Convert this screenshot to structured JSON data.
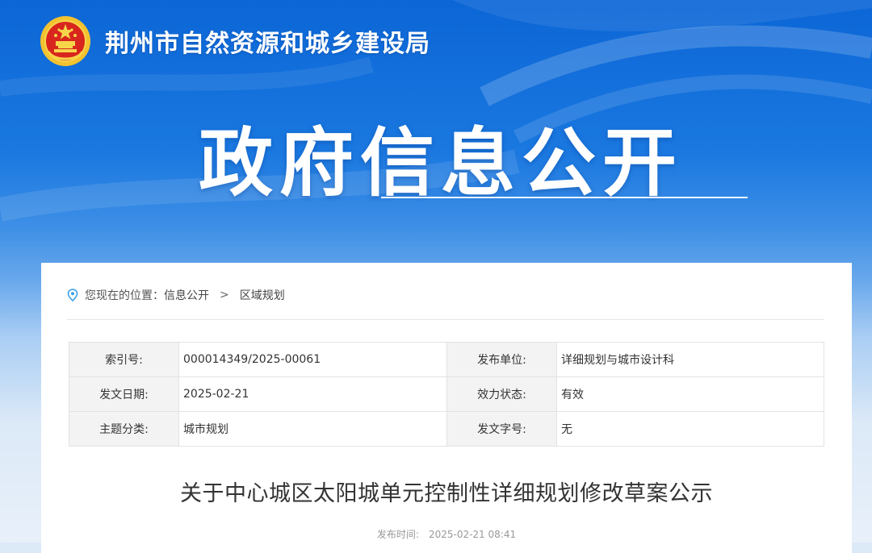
{
  "header": {
    "site_title": "荆州市自然资源和城乡建设局",
    "emblem_icon": "national-emblem-icon"
  },
  "banner": {
    "title": "政府信息公开"
  },
  "breadcrumb": {
    "prefix": "您现在的位置：",
    "items": [
      "信息公开",
      "区域规划"
    ],
    "separator": ">"
  },
  "meta": {
    "rows": [
      {
        "k1": "索引号:",
        "v1": "000014349/2025-00061",
        "k2": "发布单位:",
        "v2": "详细规划与城市设计科"
      },
      {
        "k1": "发文日期:",
        "v1": "2025-02-21",
        "k2": "效力状态:",
        "v2": "有效"
      },
      {
        "k1": "主题分类:",
        "v1": "城市规划",
        "k2": "发文字号:",
        "v2": "无"
      }
    ]
  },
  "article": {
    "title": "关于中心城区太阳城单元控制性详细规划修改草案公示",
    "publish_label": "发布时间:",
    "publish_time": "2025-02-21 08:41"
  },
  "colors": {
    "brand_blue": "#0c66d6",
    "table_key_bg": "#f3f3f3",
    "pin_icon": "#3aa0e6"
  }
}
